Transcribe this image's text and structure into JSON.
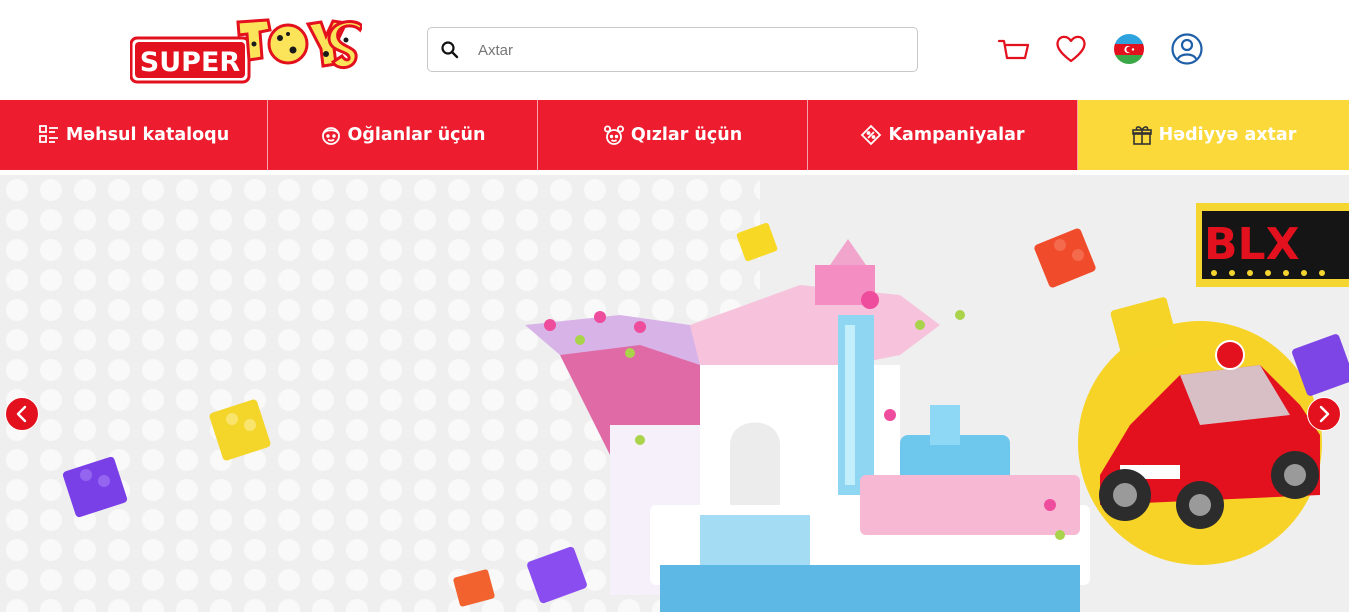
{
  "header": {
    "logo_text_main": "SUPER",
    "logo_text_secondary": "TOYS",
    "search_placeholder": "Axtar",
    "icons": [
      "cart-icon",
      "heart-icon",
      "azerbaijan-flag-icon",
      "user-icon"
    ]
  },
  "nav": {
    "items": [
      {
        "label": "Məhsul kataloqu",
        "icon": "catalog-icon"
      },
      {
        "label": "Oğlanlar üçün",
        "icon": "boy-face-icon"
      },
      {
        "label": "Qızlar üçün",
        "icon": "girl-face-icon"
      },
      {
        "label": "Kampaniyalar",
        "icon": "discount-tag-icon"
      },
      {
        "label": "Hədiyyə axtar",
        "icon": "gift-icon"
      }
    ]
  },
  "banner": {
    "brand_label": "BLX"
  },
  "colors": {
    "brand_red": "#ed1c2e",
    "accent_yellow": "#fbd93b"
  }
}
